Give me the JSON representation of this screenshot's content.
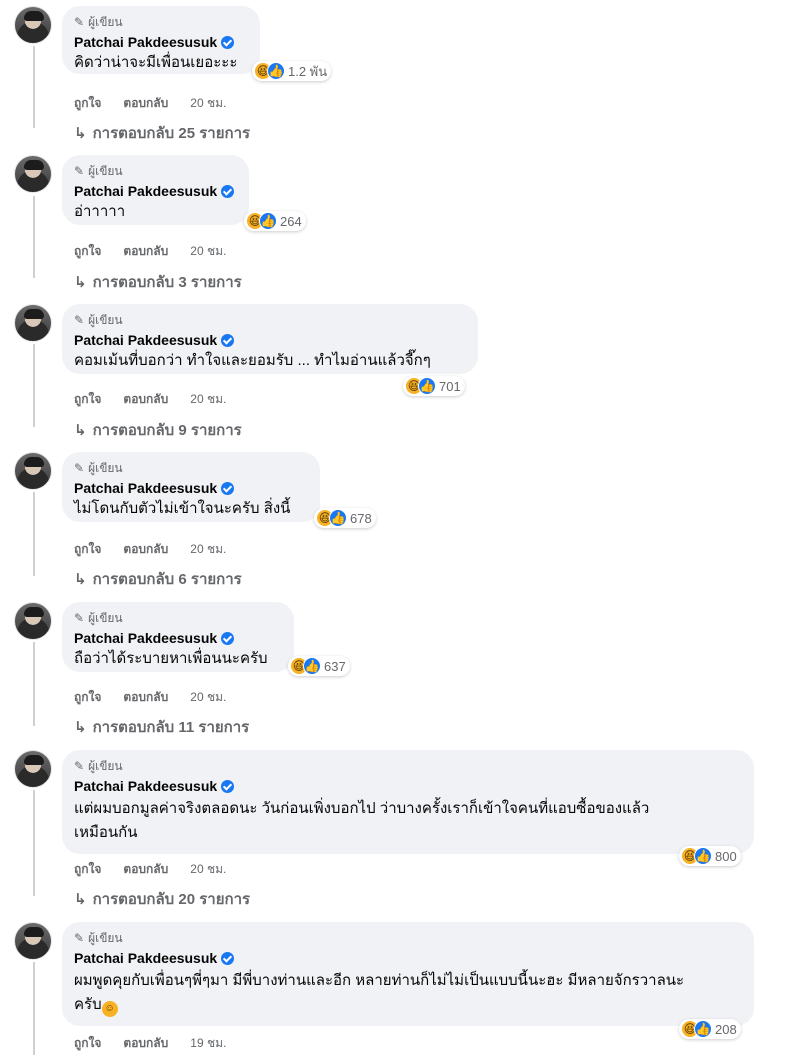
{
  "author_badge": "ผู้เขียน",
  "author_name": "Patchai Pakdeesusuk",
  "actions": {
    "like": "ถูกใจ",
    "reply": "ตอบกลับ"
  },
  "comments": [
    {
      "text": "คิดว่าน่าจะมีเพื่อนเยอะะะ",
      "reaction_count": "1.2 พัน",
      "time": "20 ชม.",
      "replies": "การตอบกลับ 25 รายการ"
    },
    {
      "text": "อ่าาาาา",
      "reaction_count": "264",
      "time": "20 ชม.",
      "replies": "การตอบกลับ 3 รายการ"
    },
    {
      "text": "คอมเม้นที่บอกว่า ทำใจและยอมรับ ... ทำไมอ่านแล้วจี๊กๆ",
      "reaction_count": "701",
      "time": "20 ชม.",
      "replies": "การตอบกลับ 9 รายการ"
    },
    {
      "text": "ไม่โดนกับตัวไม่เข้าใจนะครับ สิ่งนี้",
      "reaction_count": "678",
      "time": "20 ชม.",
      "replies": "การตอบกลับ 6 รายการ"
    },
    {
      "text": "ถือว่าได้ระบายหาเพื่อนนะครับ",
      "reaction_count": "637",
      "time": "20 ชม.",
      "replies": "การตอบกลับ 11 รายการ"
    },
    {
      "text": "แต่ผมบอกมูลค่าจริงตลอดนะ วันก่อนเพิ่งบอกไป ว่าบางครั้งเราก็เข้าใจคนที่แอบซื้อของแล้ว\nเหมือนกัน",
      "reaction_count": "800",
      "time": "20 ชม.",
      "replies": "การตอบกลับ 20 รายการ"
    },
    {
      "text": "ผมพูดคุยกับเพื่อนๆพี่ๆมา มีพี่บางท่านและอีก หลายท่านก็ไม่ไม่เป็นแบบนี้นะฮะ มีหลายจักรวาลนะ\nครับ",
      "reaction_count": "208",
      "time": "19 ชม.",
      "replies": ""
    }
  ]
}
